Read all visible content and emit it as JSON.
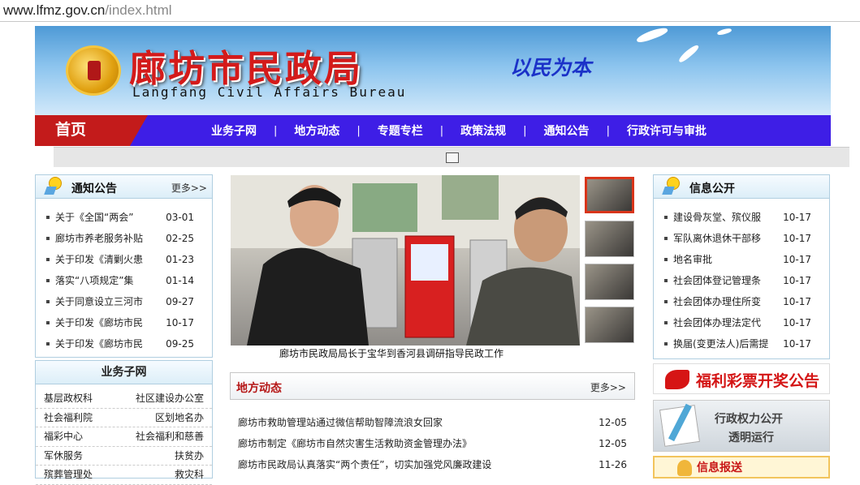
{
  "browser": {
    "url_domain": "www.lfmz.gov.cn",
    "url_path": "/index.html"
  },
  "header": {
    "title_cn": "廊坊市民政局",
    "title_en": "Langfang Civil Affairs Bureau",
    "slogan": "以民为本"
  },
  "nav": {
    "home": "首页",
    "items": [
      "业务子网",
      "地方动态",
      "专题专栏",
      "政策法规",
      "通知公告",
      "行政许可与审批"
    ],
    "separator": "|"
  },
  "notices": {
    "title": "通知公告",
    "more": "更多>>",
    "items": [
      {
        "text": "关于《全国“两会”",
        "date": "03-01"
      },
      {
        "text": "廊坊市养老服务补贴",
        "date": "02-25"
      },
      {
        "text": "关于印发《清剿火患",
        "date": "01-23"
      },
      {
        "text": "落实“八项规定”集",
        "date": "01-14"
      },
      {
        "text": "关于同意设立三河市",
        "date": "09-27"
      },
      {
        "text": "关于印发《廊坊市民",
        "date": "10-17"
      },
      {
        "text": "关于印发《廊坊市民",
        "date": "09-25"
      }
    ]
  },
  "subnet": {
    "title": "业务子网",
    "rows": [
      [
        "基层政权科",
        "社区建设办公室"
      ],
      [
        "社会福利院",
        "区划地名办"
      ],
      [
        "福彩中心",
        "社会福利和慈善"
      ],
      [
        "军休服务",
        "扶贫办"
      ],
      [
        "殡葬管理处",
        "救灾科"
      ]
    ]
  },
  "featured": {
    "caption": "廊坊市民政局局长于宝华到香河县调研指导民政工作"
  },
  "local_news": {
    "title": "地方动态",
    "more": "更多>>",
    "items": [
      {
        "text": "廊坊市救助管理站通过微信帮助智障流浪女回家",
        "date": "12-05"
      },
      {
        "text": "廊坊市制定《廊坊市自然灾害生活救助资金管理办法》",
        "date": "12-05"
      },
      {
        "text": "廊坊市民政局认真落实“两个责任”，切实加强党风廉政建设",
        "date": "11-26"
      }
    ]
  },
  "info": {
    "title": "信息公开",
    "items": [
      {
        "text": "建设骨灰堂、殡仪服",
        "date": "10-17"
      },
      {
        "text": "军队离休退休干部移",
        "date": "10-17"
      },
      {
        "text": "地名审批",
        "date": "10-17"
      },
      {
        "text": "社会团体登记管理条",
        "date": "10-17"
      },
      {
        "text": "社会团体办理住所变",
        "date": "10-17"
      },
      {
        "text": "社会团体办理法定代",
        "date": "10-17"
      },
      {
        "text": "换届(变更法人)后需提",
        "date": "10-17"
      }
    ]
  },
  "lottery": {
    "text": "福利彩票开奖公告"
  },
  "admin_power": {
    "line1": "行政权力公开",
    "line2": "透明运行"
  },
  "info_report": {
    "text": "信息报送"
  }
}
